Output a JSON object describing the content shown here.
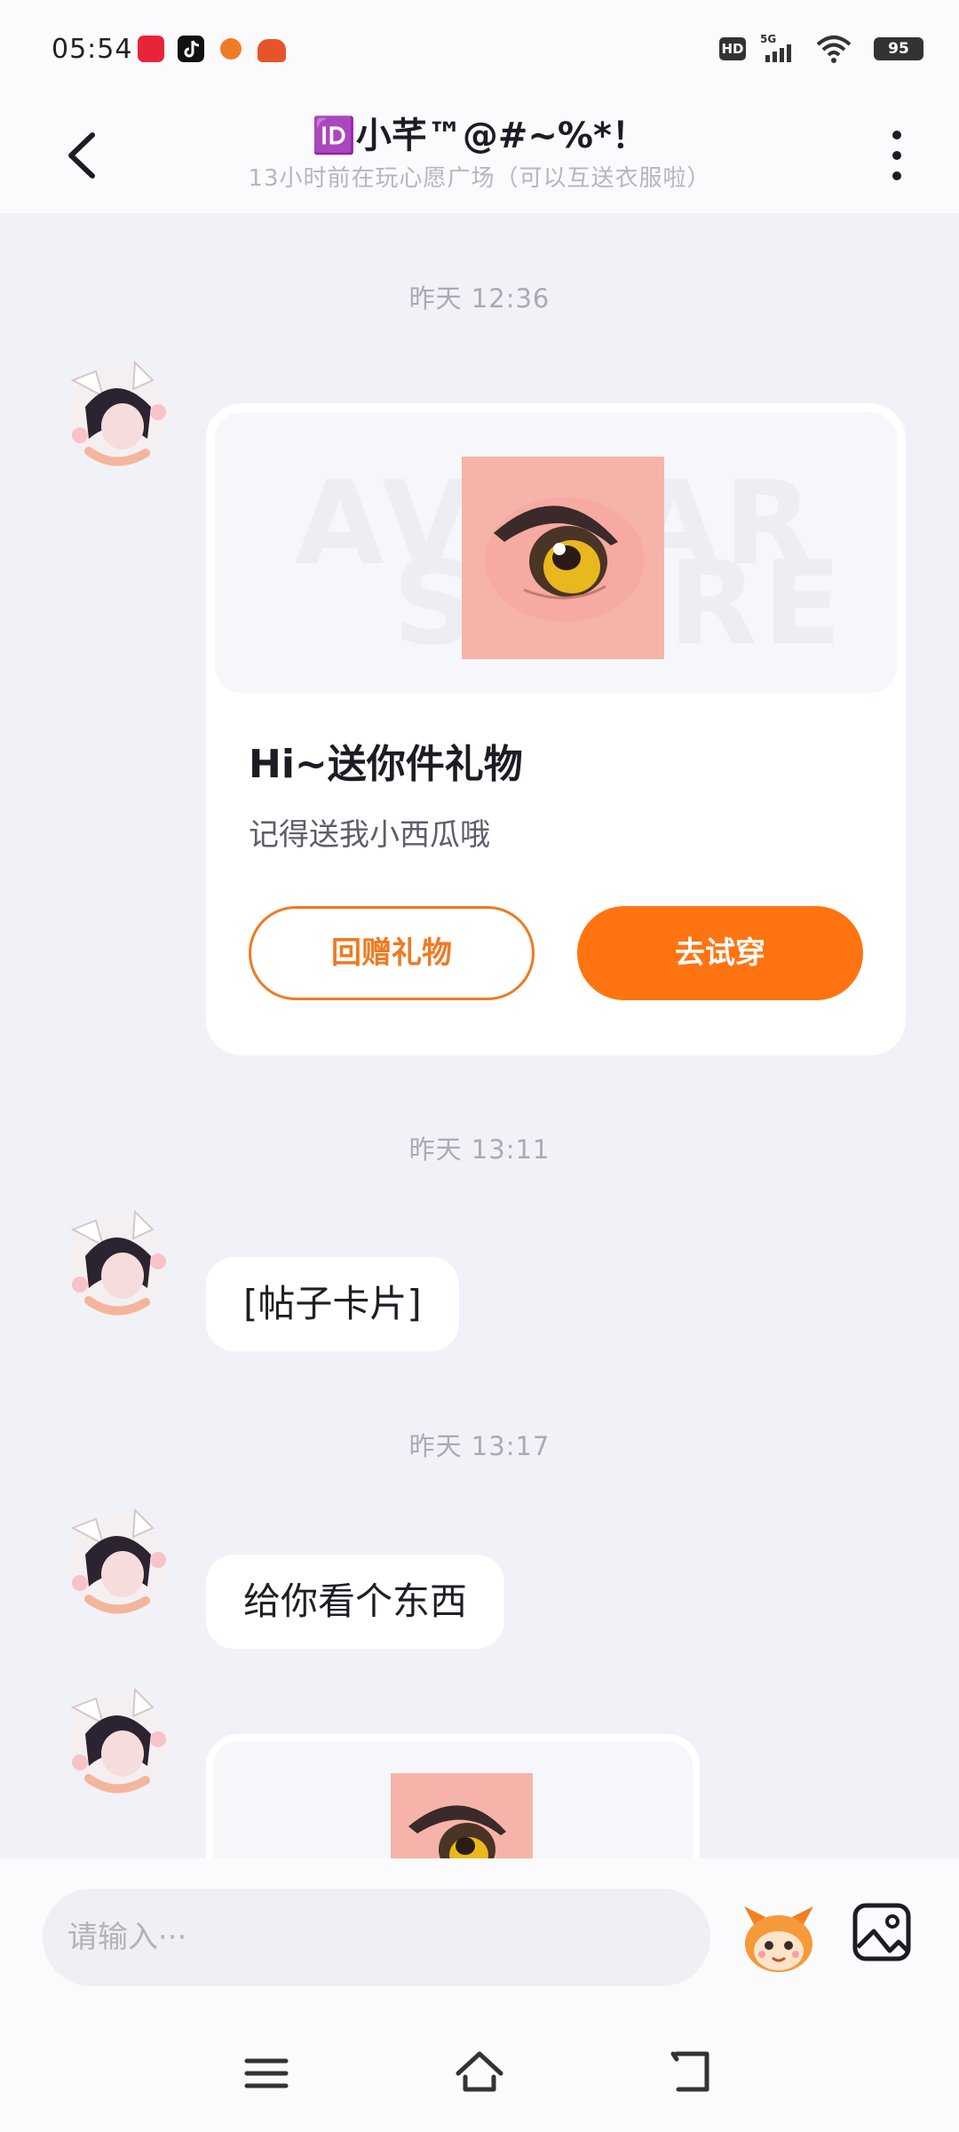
{
  "status_bar": {
    "time": "05:54",
    "hd": "HD",
    "network": "5G",
    "battery": "95",
    "app_icons": [
      "xiaohongshu-icon",
      "tiktok-icon",
      "basketball-icon",
      "game-app-icon"
    ]
  },
  "header": {
    "title": "🆔小芊™@#~%*！",
    "subtitle": "13小时前在玩心愿广场（可以互送衣服啦）"
  },
  "messages": {
    "ts1": "昨天 12:36",
    "gift_card": {
      "watermark_line1": "AVATAR",
      "watermark_line2": "STORE",
      "title": "Hi~送你件礼物",
      "desc": "记得送我小西瓜哦",
      "btn_return": "回赠礼物",
      "btn_try": "去试穿"
    },
    "ts2": "昨天 13:11",
    "msg2": "[帖子卡片]",
    "ts3": "昨天 13:17",
    "msg3": "给你看个东西"
  },
  "input": {
    "placeholder": "请输入···"
  },
  "colors": {
    "accent": "#ff7410",
    "background": "#f1f2f7",
    "bubble": "#ffffff"
  }
}
